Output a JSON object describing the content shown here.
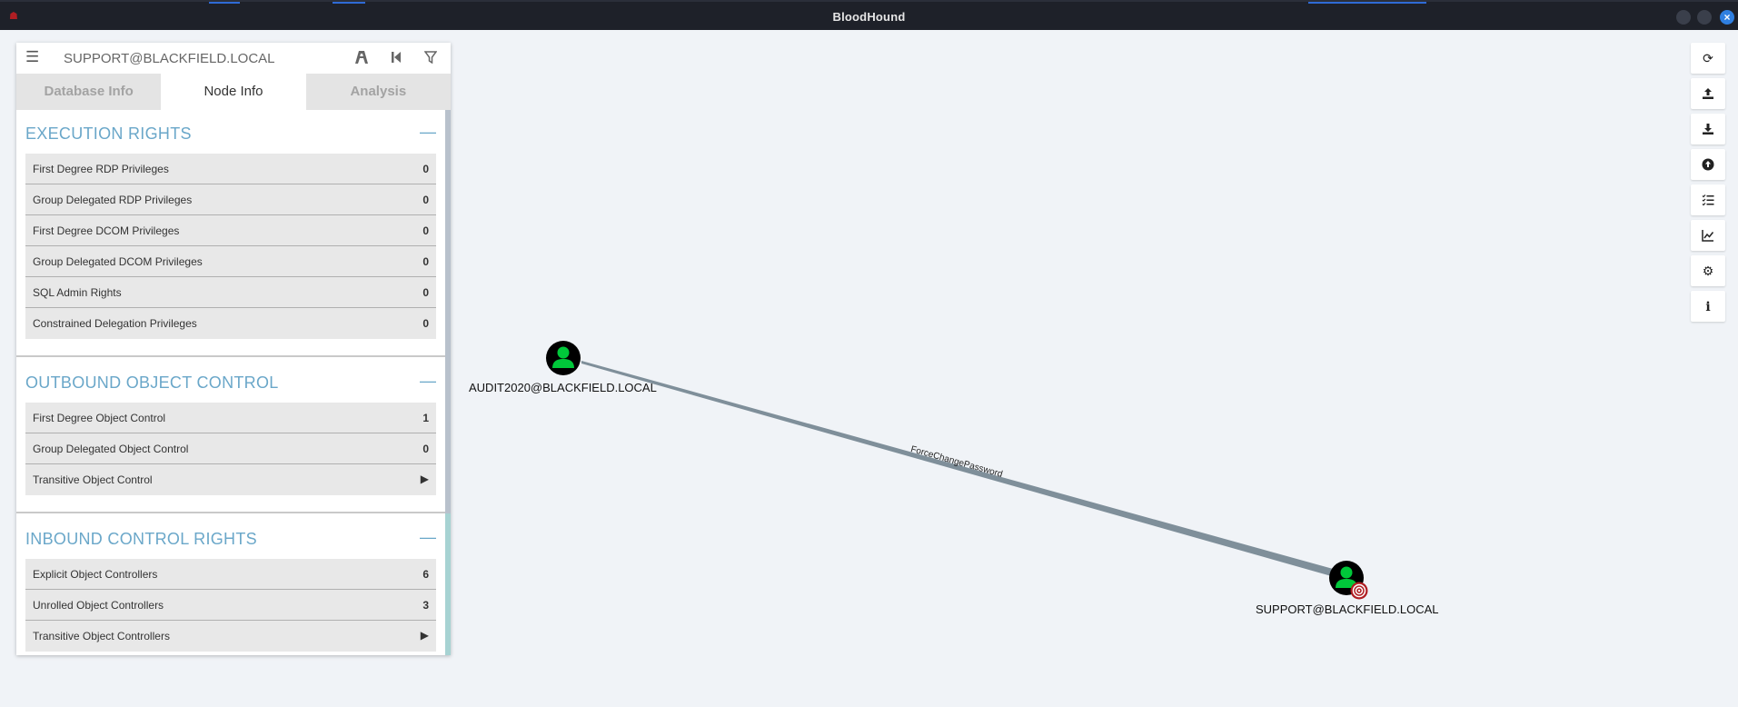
{
  "window": {
    "title": "BloodHound",
    "icon": "bloodhound-logo-icon",
    "controls": [
      "minimize-icon",
      "maximize-icon",
      "close-icon"
    ]
  },
  "search": {
    "value": "SUPPORT@BLACKFIELD.LOCAL",
    "icons": [
      "menu-icon",
      "pathfinding-icon",
      "back-icon",
      "filter-icon"
    ]
  },
  "tabs": [
    {
      "label": "Database Info",
      "active": false
    },
    {
      "label": "Node Info",
      "active": true
    },
    {
      "label": "Analysis",
      "active": false
    }
  ],
  "sections": [
    {
      "title": "EXECUTION RIGHTS",
      "rows": [
        {
          "label": "First Degree RDP Privileges",
          "value": "0"
        },
        {
          "label": "Group Delegated RDP Privileges",
          "value": "0"
        },
        {
          "label": "First Degree DCOM Privileges",
          "value": "0"
        },
        {
          "label": "Group Delegated DCOM Privileges",
          "value": "0"
        },
        {
          "label": "SQL Admin Rights",
          "value": "0"
        },
        {
          "label": "Constrained Delegation Privileges",
          "value": "0"
        }
      ]
    },
    {
      "title": "OUTBOUND OBJECT CONTROL",
      "rows": [
        {
          "label": "First Degree Object Control",
          "value": "1"
        },
        {
          "label": "Group Delegated Object Control",
          "value": "0"
        },
        {
          "label": "Transitive Object Control",
          "value": "▶"
        }
      ]
    },
    {
      "title": "INBOUND CONTROL RIGHTS",
      "rows": [
        {
          "label": "Explicit Object Controllers",
          "value": "6"
        },
        {
          "label": "Unrolled Object Controllers",
          "value": "3"
        },
        {
          "label": "Transitive Object Controllers",
          "value": "▶"
        }
      ]
    }
  ],
  "graph": {
    "source_node": {
      "label": "AUDIT2020@BLACKFIELD.LOCAL",
      "icon": "user-icon",
      "color": "#00c83a"
    },
    "target_node": {
      "label": "SUPPORT@BLACKFIELD.LOCAL",
      "icon": "user-icon",
      "badge": "target-icon",
      "color": "#00c83a"
    },
    "edge": {
      "label": "ForceChangePassword",
      "color": "#7f8f9a"
    }
  },
  "toolbar": [
    "refresh-icon",
    "upload-icon",
    "download-icon",
    "import-icon",
    "query-list-icon",
    "chart-icon",
    "settings-icon",
    "info-icon"
  ],
  "colors": {
    "accent": "#6aa7c9",
    "node_user": "#00c83a",
    "background": "#f0f3f7",
    "titlebar": "#1e2129"
  }
}
